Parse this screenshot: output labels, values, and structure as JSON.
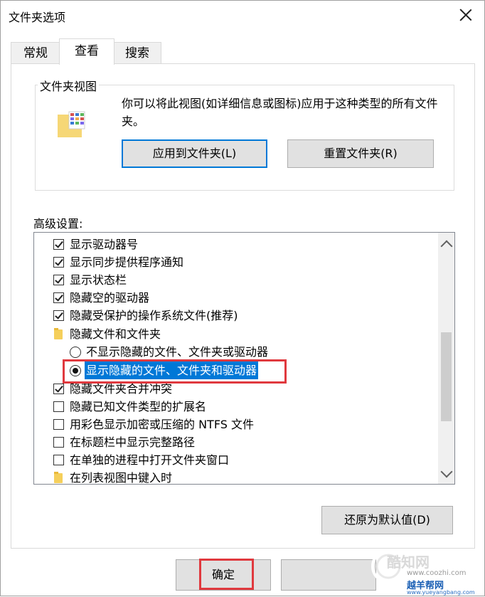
{
  "window": {
    "title": "文件夹选项"
  },
  "tabs": [
    {
      "label": "常规",
      "active": false
    },
    {
      "label": "查看",
      "active": true
    },
    {
      "label": "搜索",
      "active": false
    }
  ],
  "folder_views": {
    "group_label": "文件夹视图",
    "description": "你可以将此视图(如详细信息或图标)应用于这种类型的所有文件夹。",
    "apply_button": "应用到文件夹(L)",
    "reset_button": "重置文件夹(R)"
  },
  "advanced": {
    "label": "高级设置:",
    "items": [
      {
        "type": "checkbox",
        "checked": true,
        "label": "显示驱动器号"
      },
      {
        "type": "checkbox",
        "checked": true,
        "label": "显示同步提供程序通知"
      },
      {
        "type": "checkbox",
        "checked": true,
        "label": "显示状态栏"
      },
      {
        "type": "checkbox",
        "checked": true,
        "label": "隐藏空的驱动器"
      },
      {
        "type": "checkbox",
        "checked": true,
        "label": "隐藏受保护的操作系统文件(推荐)"
      },
      {
        "type": "folder",
        "label": "隐藏文件和文件夹"
      },
      {
        "type": "radio",
        "checked": false,
        "label": "不显示隐藏的文件、文件夹或驱动器"
      },
      {
        "type": "radio",
        "checked": true,
        "label": "显示隐藏的文件、文件夹和驱动器",
        "selected": true
      },
      {
        "type": "checkbox",
        "checked": true,
        "label": "隐藏文件夹合并冲突"
      },
      {
        "type": "checkbox",
        "checked": false,
        "label": "隐藏已知文件类型的扩展名"
      },
      {
        "type": "checkbox",
        "checked": false,
        "label": "用彩色显示加密或压缩的 NTFS 文件"
      },
      {
        "type": "checkbox",
        "checked": false,
        "label": "在标题栏中显示完整路径"
      },
      {
        "type": "checkbox",
        "checked": false,
        "label": "在单独的进程中打开文件夹窗口"
      },
      {
        "type": "folder",
        "label": "在列表视图中键入时"
      }
    ]
  },
  "restore_button": "还原为默认值(D)",
  "footer": {
    "ok_button": "确定"
  },
  "watermark": {
    "brand": "酷知网",
    "domain": "www.coozhi.com",
    "brand2": "越羊帮网",
    "domain2": "www.yueyangbang.com"
  },
  "colors": {
    "selection": "#0078d7",
    "highlight": "#e0393e",
    "focus_border": "#0078d7"
  }
}
